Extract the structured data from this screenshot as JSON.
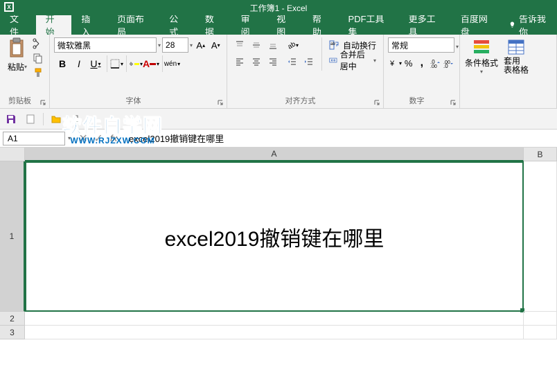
{
  "titlebar": {
    "title": "工作簿1  -  Excel"
  },
  "menu": {
    "file": "文件",
    "home": "开始",
    "insert": "插入",
    "pagelayout": "页面布局",
    "formulas": "公式",
    "data": "数据",
    "review": "审阅",
    "view": "视图",
    "help": "帮助",
    "pdf": "PDF工具集",
    "more": "更多工具",
    "baidu": "百度网盘",
    "tellme": "告诉我你"
  },
  "ribbon": {
    "clipboard": {
      "label": "剪贴板",
      "paste": "粘贴"
    },
    "font": {
      "label": "字体",
      "name": "微软雅黑",
      "size": "28",
      "bold": "B",
      "italic": "I",
      "underline": "U",
      "ruby": "wén"
    },
    "alignment": {
      "label": "对齐方式",
      "wrap": "自动换行",
      "merge": "合并后居中"
    },
    "number": {
      "label": "数字",
      "format": "常规"
    },
    "styles": {
      "condfmt": "条件格式",
      "tablefmt": "套用\n表格格"
    }
  },
  "namebox": "A1",
  "formula": "excel2019撤销键在哪里",
  "cells": {
    "A1": "excel2019撤销键在哪里"
  },
  "rows": [
    "1",
    "2",
    "3"
  ],
  "cols": [
    "A",
    "B"
  ],
  "watermark": {
    "text": "软件自学网",
    "url": "WWW.RJZXW.COM"
  }
}
